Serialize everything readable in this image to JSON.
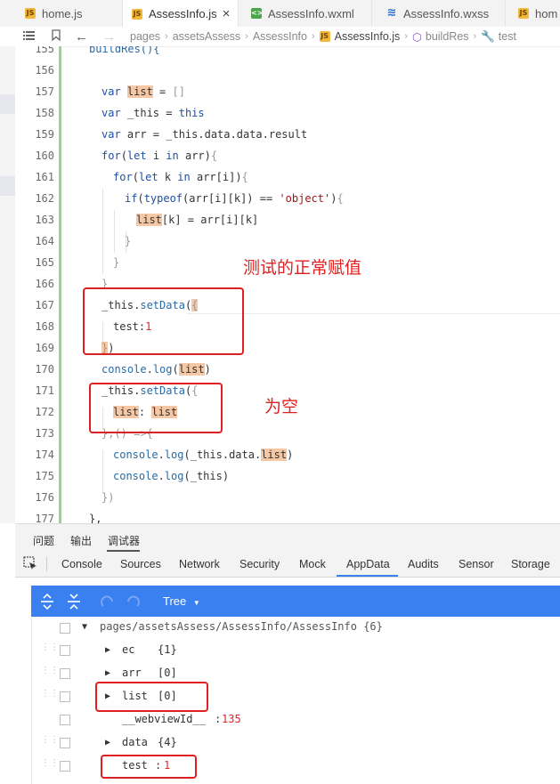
{
  "tabs": [
    {
      "label": "home.js",
      "type": "js",
      "active": false
    },
    {
      "label": "AssessInfo.js",
      "type": "js",
      "active": true,
      "close": "×"
    },
    {
      "label": "AssessInfo.wxml",
      "type": "wxml",
      "active": false
    },
    {
      "label": "AssessInfo.wxss",
      "type": "wxss",
      "active": false
    },
    {
      "label": "hom",
      "type": "js",
      "active": false
    }
  ],
  "breadcrumb": {
    "items": [
      "pages",
      "assetsAssess",
      "AssessInfo",
      "AssessInfo.js",
      "buildRes",
      "test"
    ]
  },
  "editor": {
    "line_numbers": [
      "155",
      "156",
      "157",
      "158",
      "159",
      "160",
      "161",
      "162",
      "163",
      "164",
      "165",
      "166",
      "167",
      "168",
      "169",
      "170",
      "171",
      "172",
      "173",
      "174",
      "175",
      "176",
      "177"
    ],
    "lines": [
      "buildRes(){",
      "",
      "var list = []",
      "var _this = this",
      "var arr = _this.data.data.result",
      "for(let i in arr){",
      "for(let k in arr[i]){",
      "if(typeof(arr[i][k]) == 'object'){",
      "list[k] = arr[i][k]",
      "}",
      "}",
      "}",
      "_this.setData({",
      "test:1",
      "})",
      "console.log(list)",
      "_this.setData({",
      "list: list",
      "},() =>{",
      "console.log(_this.data.list)",
      "console.log(_this)",
      "})",
      "},"
    ]
  },
  "annotations": {
    "normal_assign": "测试的正常赋值",
    "empty": "为空"
  },
  "bottom_panel": {
    "tabs": [
      "问题",
      "输出",
      "调试器"
    ],
    "active_tab": "调试器"
  },
  "devtools": {
    "tabs": [
      "Console",
      "Sources",
      "Network",
      "Security",
      "Mock",
      "AppData",
      "Audits",
      "Sensor",
      "Storage"
    ],
    "active": "AppData"
  },
  "appdata": {
    "view_mode": "Tree",
    "path": "pages/assetsAssess/AssessInfo/AssessInfo {6}",
    "rows": [
      {
        "key": "ec",
        "value": "{1}",
        "expandable": true
      },
      {
        "key": "arr",
        "value": "[0]",
        "expandable": true
      },
      {
        "key": "list",
        "value": "[0]",
        "expandable": true
      },
      {
        "key": "__webviewId__",
        "value": "135",
        "expandable": false
      },
      {
        "key": "data",
        "value": "{4}",
        "expandable": true
      },
      {
        "key": "test",
        "value": "1",
        "expandable": false
      }
    ]
  },
  "colors": {
    "accent": "#3a80f0",
    "annotation_red": "#e02020",
    "highlight": "#f6c7a5",
    "keyword": "#1f4fa3"
  }
}
